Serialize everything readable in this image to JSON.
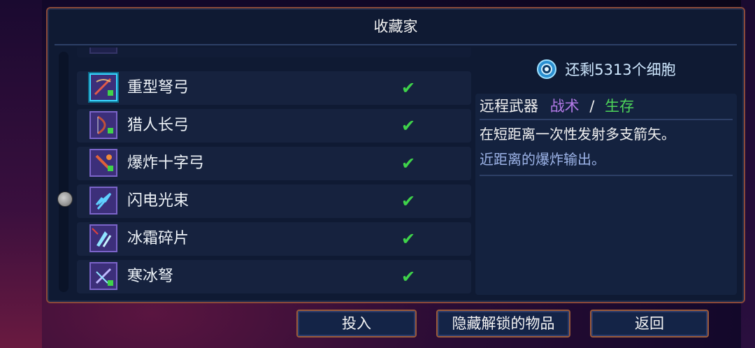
{
  "panel": {
    "title": "收藏家"
  },
  "list": {
    "items": [
      {
        "name": "",
        "selected": false,
        "unlocked": true,
        "faded": true
      },
      {
        "name": "重型弩弓",
        "selected": true,
        "unlocked": true
      },
      {
        "name": "猎人长弓",
        "selected": false,
        "unlocked": true
      },
      {
        "name": "爆炸十字弓",
        "selected": false,
        "unlocked": true
      },
      {
        "name": "闪电光束",
        "selected": false,
        "unlocked": true
      },
      {
        "name": "冰霜碎片",
        "selected": false,
        "unlocked": true
      },
      {
        "name": "寒冰弩",
        "selected": false,
        "unlocked": true
      }
    ],
    "check_glyph": "✔"
  },
  "detail": {
    "cells_text": "还剩5313个细胞",
    "category": "远程武器",
    "tag_tactic": "战术",
    "tag_separator": "/",
    "tag_survival": "生存",
    "description": "在短距离一次性发射多支箭矢。",
    "description_extra": "近距离的爆炸输出。"
  },
  "buttons": {
    "invest": "投入",
    "hide_unlocked": "隐藏解锁的物品",
    "back": "返回"
  },
  "colors": {
    "tactic": "#b47ae8",
    "survival": "#4ed65a",
    "check": "#3fd34a",
    "selection": "#38d7ff"
  }
}
